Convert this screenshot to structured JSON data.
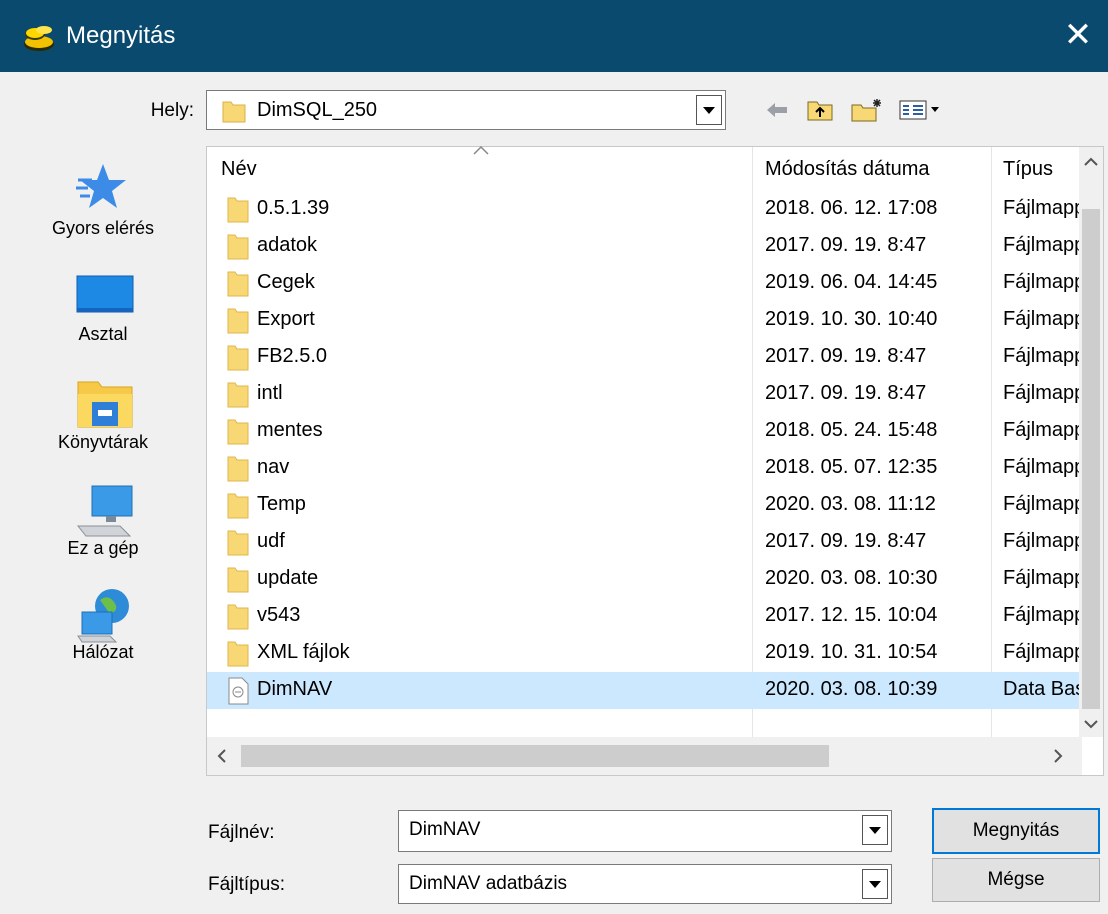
{
  "window": {
    "title": "Megnyitás",
    "close_glyph": "✕"
  },
  "location": {
    "label": "Hely:",
    "value": "DimSQL_250"
  },
  "toolbar": {
    "icons": [
      "back-arrow-icon",
      "up-folder-icon",
      "new-folder-icon",
      "view-menu-icon"
    ]
  },
  "places": [
    {
      "label": "Gyors elérés",
      "icon": "star-icon"
    },
    {
      "label": "Asztal",
      "icon": "desktop-icon"
    },
    {
      "label": "Könyvtárak",
      "icon": "libraries-icon"
    },
    {
      "label": "Ez a gép",
      "icon": "computer-icon"
    },
    {
      "label": "Hálózat",
      "icon": "network-icon"
    }
  ],
  "columns": {
    "name": "Név",
    "date": "Módosítás dátuma",
    "type": "Típus"
  },
  "files": [
    {
      "name": "0.5.1.39",
      "date": "2018. 06. 12. 17:08",
      "type": "Fájlmappa",
      "kind": "folder"
    },
    {
      "name": "adatok",
      "date": "2017. 09. 19. 8:47",
      "type": "Fájlmappa",
      "kind": "folder"
    },
    {
      "name": "Cegek",
      "date": "2019. 06. 04. 14:45",
      "type": "Fájlmappa",
      "kind": "folder"
    },
    {
      "name": "Export",
      "date": "2019. 10. 30. 10:40",
      "type": "Fájlmappa",
      "kind": "folder"
    },
    {
      "name": "FB2.5.0",
      "date": "2017. 09. 19. 8:47",
      "type": "Fájlmappa",
      "kind": "folder"
    },
    {
      "name": "intl",
      "date": "2017. 09. 19. 8:47",
      "type": "Fájlmappa",
      "kind": "folder"
    },
    {
      "name": "mentes",
      "date": "2018. 05. 24. 15:48",
      "type": "Fájlmappa",
      "kind": "folder"
    },
    {
      "name": "nav",
      "date": "2018. 05. 07. 12:35",
      "type": "Fájlmappa",
      "kind": "folder"
    },
    {
      "name": "Temp",
      "date": "2020. 03. 08. 11:12",
      "type": "Fájlmappa",
      "kind": "folder"
    },
    {
      "name": "udf",
      "date": "2017. 09. 19. 8:47",
      "type": "Fájlmappa",
      "kind": "folder"
    },
    {
      "name": "update",
      "date": "2020. 03. 08. 10:30",
      "type": "Fájlmappa",
      "kind": "folder"
    },
    {
      "name": "v543",
      "date": "2017. 12. 15. 10:04",
      "type": "Fájlmappa",
      "kind": "folder"
    },
    {
      "name": "XML fájlok",
      "date": "2019. 10. 31. 10:54",
      "type": "Fájlmappa",
      "kind": "folder"
    },
    {
      "name": "DimNAV",
      "date": "2020. 03. 08. 10:39",
      "type": "Data Base",
      "kind": "file",
      "selected": true
    }
  ],
  "filename": {
    "label": "Fájlnév:",
    "value": "DimNAV"
  },
  "filetype": {
    "label": "Fájltípus:",
    "value": "DimNAV adatbázis"
  },
  "buttons": {
    "open": "Megnyitás",
    "cancel": "Mégse"
  }
}
